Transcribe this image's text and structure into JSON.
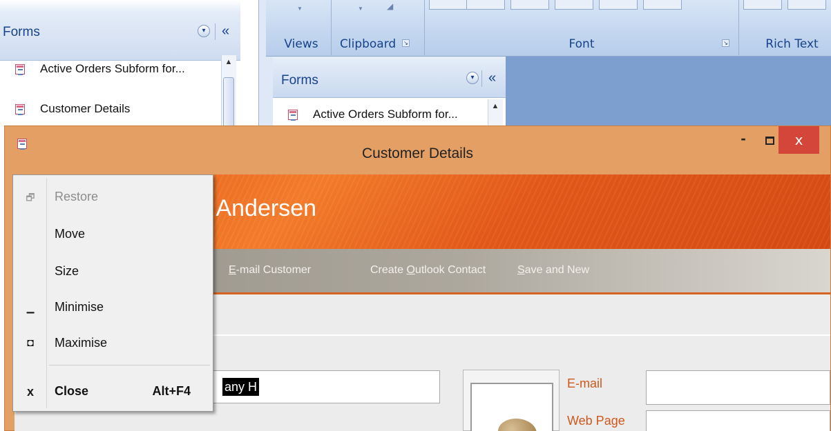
{
  "nav_pane": {
    "title": "Forms",
    "items": [
      {
        "label": "Active Orders Subform for..."
      },
      {
        "label": "Customer Details"
      }
    ]
  },
  "ribbon": {
    "groups": [
      {
        "label": "Views"
      },
      {
        "label": "Clipboard"
      },
      {
        "label": "Font"
      },
      {
        "label": "Rich Text"
      }
    ]
  },
  "nav_pane_2": {
    "title": "Forms",
    "items": [
      {
        "label": "Active Orders Subform for..."
      }
    ]
  },
  "window": {
    "title": "Customer Details",
    "close_glyph": "x",
    "minimize_glyph": "-"
  },
  "form": {
    "header_name": "n Andersen",
    "actions": {
      "email_prefix": "E",
      "email_rest": "-mail Customer",
      "outlook_prefix": "Create ",
      "outlook_accel": "O",
      "outlook_rest": "utlook Contact",
      "save_accel": "S",
      "save_rest": "ave and New"
    },
    "company_value": "any H",
    "labels": {
      "email": "E-mail",
      "web_page": "Web Page"
    }
  },
  "system_menu": {
    "items": [
      {
        "label": "Restore",
        "icon": "restore-icon",
        "enabled": false
      },
      {
        "label": "Move",
        "icon": "",
        "enabled": true
      },
      {
        "label": "Size",
        "icon": "",
        "enabled": true
      },
      {
        "label": "Minimise",
        "icon": "minimize-icon",
        "enabled": true
      },
      {
        "label": "Maximise",
        "icon": "maximize-icon",
        "enabled": true
      },
      {
        "label": "Close",
        "icon": "close-icon",
        "shortcut": "Alt+F4",
        "enabled": true
      }
    ],
    "glyphs": {
      "restore": "🗗",
      "minimise": "▁",
      "maximise": "◘",
      "close": "x"
    }
  },
  "colors": {
    "accent_orange": "#e65a1a",
    "label_orange": "#d0571c",
    "title_bar": "#e4a064",
    "close_red": "#d4453a",
    "nav_blue": "#15428b"
  }
}
